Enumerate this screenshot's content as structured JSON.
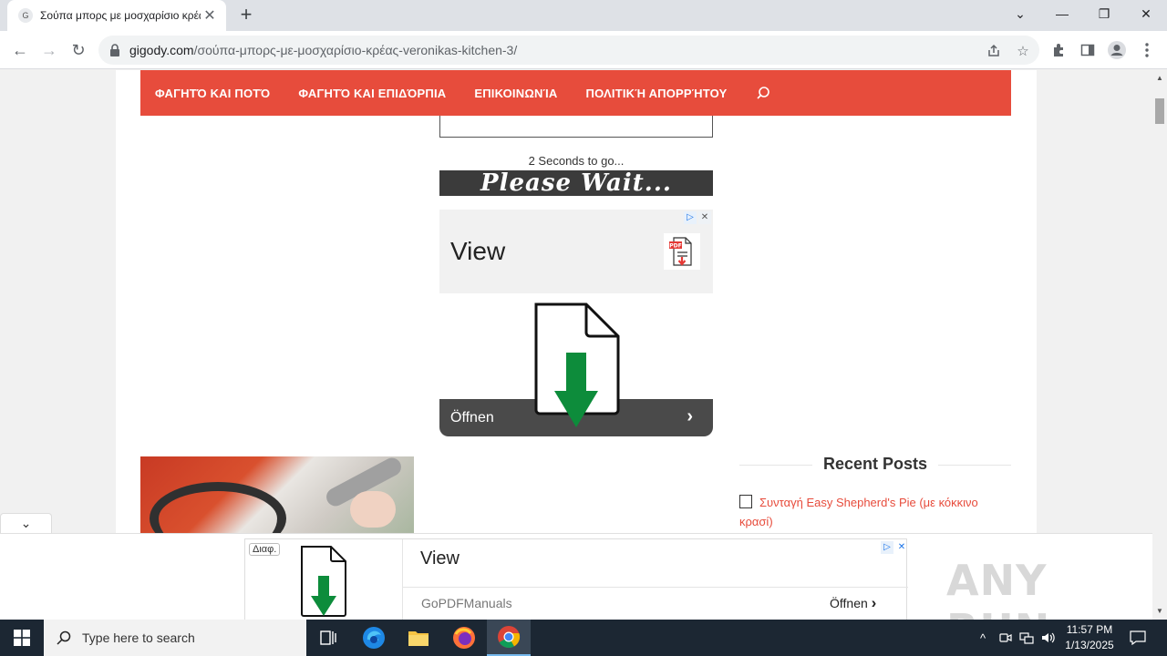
{
  "browser": {
    "tab": {
      "favicon_letter": "G",
      "title": "Σούπα μπορς με μοσχαρίσιο κρέας",
      "close": "✕",
      "new_tab": "+"
    },
    "window_controls": {
      "dropdown": "⌄",
      "minimize": "—",
      "restore": "❐",
      "close": "✕"
    },
    "nav": {
      "back": "←",
      "forward": "→",
      "reload": "↻"
    },
    "url": {
      "host": "gigody.com",
      "path": "/σούπα-μπορς-με-μοσχαρίσιο-κρέας-veronikas-kitchen-3/"
    },
    "icons": [
      "share-icon",
      "bookmark-star-icon",
      "extensions-icon",
      "sidepanel-icon",
      "profile-icon",
      "menu-icon"
    ]
  },
  "page": {
    "nav": {
      "items": [
        "ΦΑΓΗΤΌ ΚΑΙ ΠΟΤΌ",
        "ΦΑΓΗΤΌ ΚΑΙ ΕΠΙΔΌΡΠΙΑ",
        "ΕΠΙΚΟΙΝΩΝΊΑ",
        "ΠΟΛΙΤΙΚΉ ΑΠΟΡΡΉΤΟΥ"
      ],
      "search_icon": "search-icon"
    },
    "countdown": "2 Seconds to go...",
    "please_wait": "Please Wait...",
    "ad_view": {
      "title": "View",
      "pdf_badge": "PDF"
    },
    "big_ad": {
      "open_label": "Öffnen",
      "chevron": "›"
    },
    "recent_posts": {
      "heading": "Recent Posts",
      "items": [
        "Συνταγή Easy Shepherd's Pie (με κόκκινο κρασί)"
      ]
    },
    "collapse": "⌄",
    "anchor_ad": {
      "tag": "Διαφ.",
      "title": "View",
      "brand": "GoPDFManuals",
      "open": "Öffnen",
      "chevron": "›"
    },
    "watermark": "ANY RUN"
  },
  "taskbar": {
    "search_placeholder": "Type here to search",
    "time": "11:57 PM",
    "date": "1/13/2025",
    "apps": [
      "task-view-icon",
      "edge-icon",
      "file-explorer-icon",
      "firefox-icon",
      "chrome-icon"
    ]
  },
  "colors": {
    "accent": "#e74c3c",
    "taskbar": "#1c2733",
    "ad_green": "#0d8c3b"
  }
}
